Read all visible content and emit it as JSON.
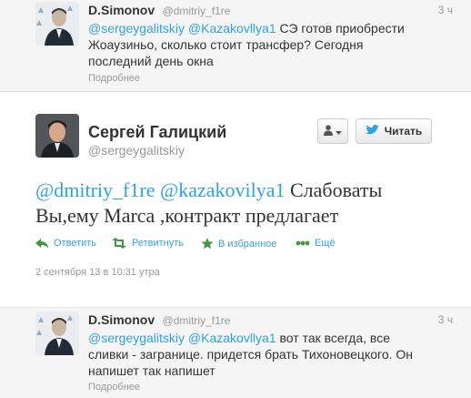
{
  "reply_top": {
    "name": "D.Simonov",
    "handle": "@dmitriy_f1re",
    "time": "3 ч",
    "text_line1_mentions": "@sergeygalitskiy @Kazakovllya1",
    "text_line1_rest": " СЭ готов приобрести",
    "text_line2": "Жоаузиньо, сколько стоит трансфер? Сегодня",
    "text_line3": "последний день окна",
    "details": "Подробнее"
  },
  "main": {
    "name": "Сергей Галицкий",
    "handle": "@sergeygalitskiy",
    "follow_label": "Читать",
    "mention1": "@dmitriy_f1re",
    "mention2": "@kazakovilya1",
    "text_rest": " Слабоваты",
    "text_line2": "Вы,ему Marca ,контракт предлагает",
    "actions": {
      "reply": "Ответить",
      "retweet": "Ретвитнуть",
      "favorite": "В избранное",
      "more": "Ещё"
    },
    "timestamp": "2 сентября 13 в 10:31 утра"
  },
  "reply_bottom": {
    "name": "D.Simonov",
    "handle": "@dmitriy_f1re",
    "time": "3 ч",
    "text_line1_mentions": "@sergeygalitskiy @Kazakovllya1",
    "text_line1_rest": " вот так всегда, все",
    "text_line2": "сливки - загранице. придется брать Тихоновецкого. Он",
    "text_line3": "напишет так напишет",
    "details": "Подробнее"
  },
  "colors": {
    "link": "#2fa2e6",
    "muted": "#999999",
    "text": "#333333",
    "reply_bg": "#f5f5f5"
  },
  "icons": [
    "reply-arrow-icon",
    "retweet-icon",
    "star-icon",
    "more-dots-icon",
    "user-icon",
    "twitter-bird-icon",
    "caret-down-icon"
  ]
}
